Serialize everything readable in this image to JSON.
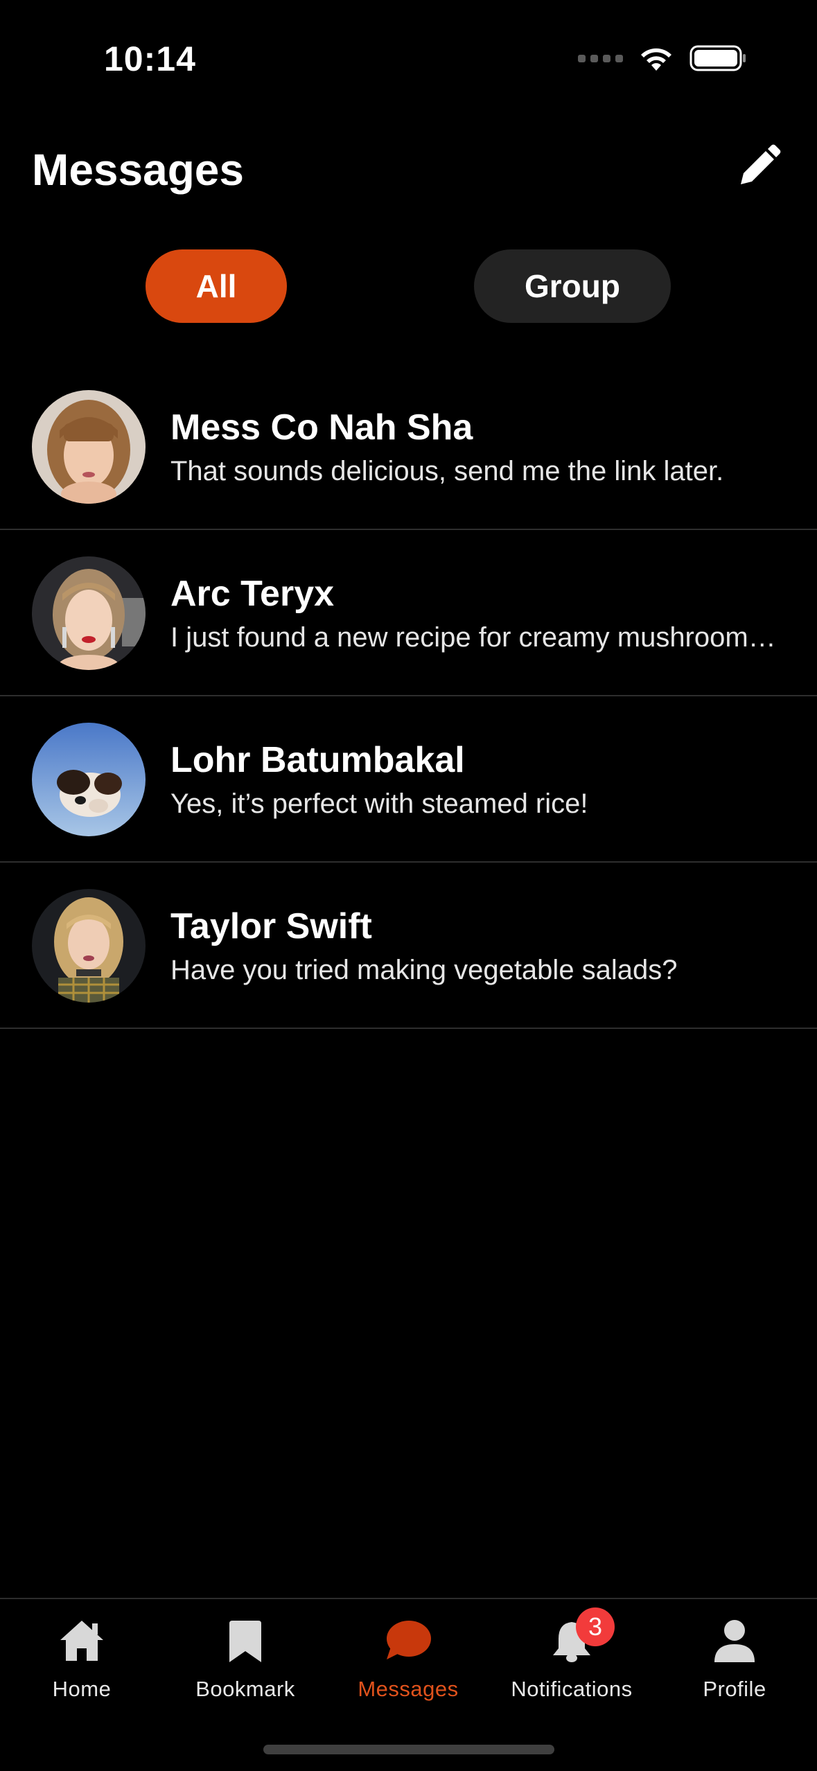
{
  "status": {
    "time": "10:14"
  },
  "header": {
    "title": "Messages"
  },
  "segments": {
    "all": "All",
    "group": "Group",
    "active": "All"
  },
  "conversations": [
    {
      "name": "Mess Co Nah Sha",
      "message": "That sounds delicious, send me the link later.",
      "avatar": "woman-bangs-avatar"
    },
    {
      "name": "Arc Teryx",
      "message": "I just found a new recipe for creamy mushroom soup!",
      "avatar": "woman-earrings-avatar"
    },
    {
      "name": "Lohr Batumbakal",
      "message": "Yes, it’s perfect with steamed rice!",
      "avatar": "dog-avatar"
    },
    {
      "name": "Taylor Swift",
      "message": "Have you tried making vegetable salads?",
      "avatar": "woman-plaid-avatar"
    }
  ],
  "tabbar": {
    "home": "Home",
    "bookmark": "Bookmark",
    "messages": "Messages",
    "notifications": "Notifications",
    "notifications_badge": "3",
    "profile": "Profile",
    "active": "Messages"
  },
  "colors": {
    "accent": "#d9480f",
    "badge": "#f23b3b",
    "background": "#000000",
    "pill_inactive": "#232323"
  }
}
